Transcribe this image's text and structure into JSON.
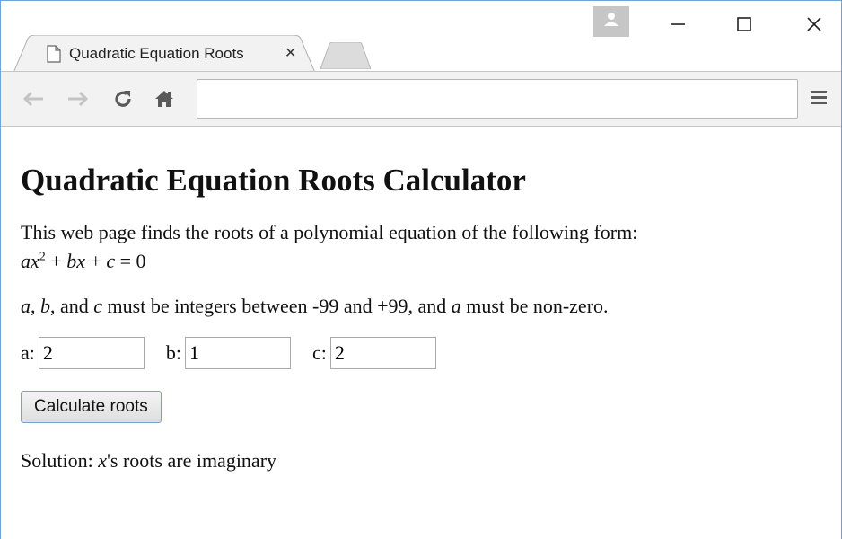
{
  "browser": {
    "tab_title": "Quadratic Equation Roots",
    "address_value": ""
  },
  "page": {
    "title": "Quadratic Equation Roots Calculator",
    "intro_text": "This web page finds the roots of a polynomial equation of the following form:",
    "eq_a": "ax",
    "eq_exp": "2",
    "eq_rest1": " + ",
    "eq_b": "bx",
    "eq_rest2": " + ",
    "eq_c": "c",
    "eq_rest3": " = 0",
    "cond_a": "a",
    "cond_sep1": ", ",
    "cond_b": "b",
    "cond_sep2": ", and ",
    "cond_c": "c",
    "cond_mid": " must be integers between -99 and +99, and ",
    "cond_a2": "a",
    "cond_end": " must be non-zero.",
    "label_a": "a:",
    "label_b": "b:",
    "label_c": "c:",
    "value_a": "2",
    "value_b": "1",
    "value_c": "2",
    "button_label": "Calculate roots",
    "solution_prefix": "Solution: ",
    "solution_var": "x",
    "solution_text": "'s roots are imaginary"
  },
  "icons": {
    "page": "page-icon",
    "close": "close-icon",
    "back": "back-arrow-icon",
    "forward": "forward-arrow-icon",
    "reload": "reload-icon",
    "home": "home-icon",
    "menu": "menu-icon",
    "profile": "profile-icon"
  }
}
